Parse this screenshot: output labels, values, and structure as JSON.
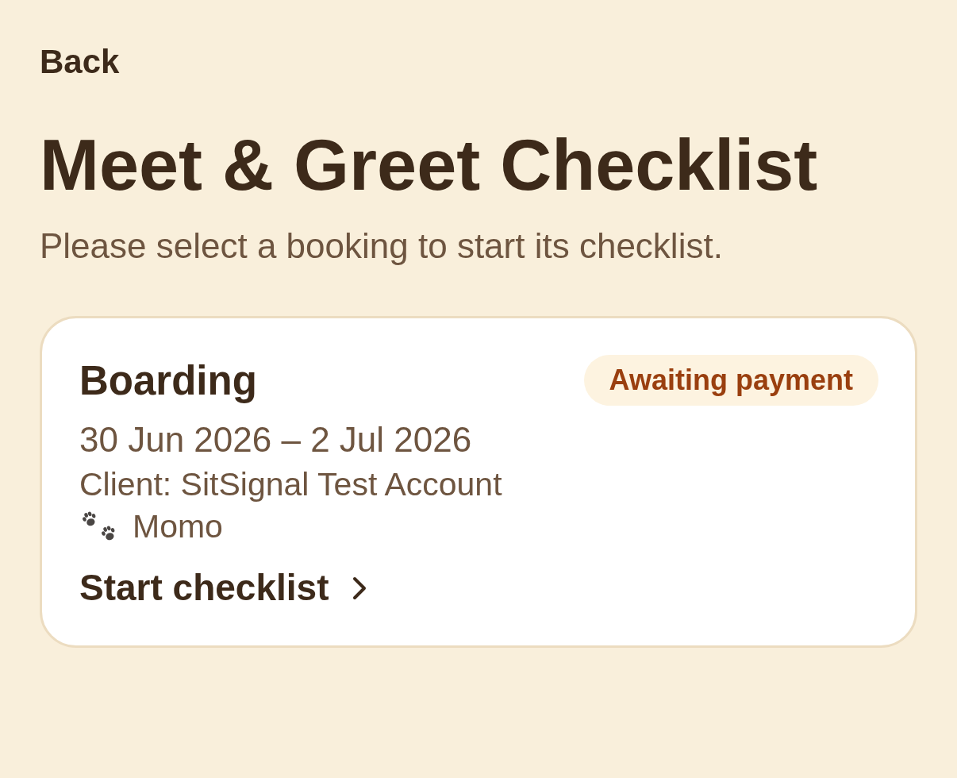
{
  "back_link": {
    "label": "Back"
  },
  "page": {
    "title": "Meet & Greet Checklist",
    "subtitle": "Please select a booking to start its checklist."
  },
  "bookings": [
    {
      "service": "Boarding",
      "status": "Awaiting payment",
      "dates": "30 Jun 2026 – 2 Jul 2026",
      "client": "Client: SitSignal Test Account",
      "pet": "Momo",
      "action": "Start checklist"
    }
  ]
}
